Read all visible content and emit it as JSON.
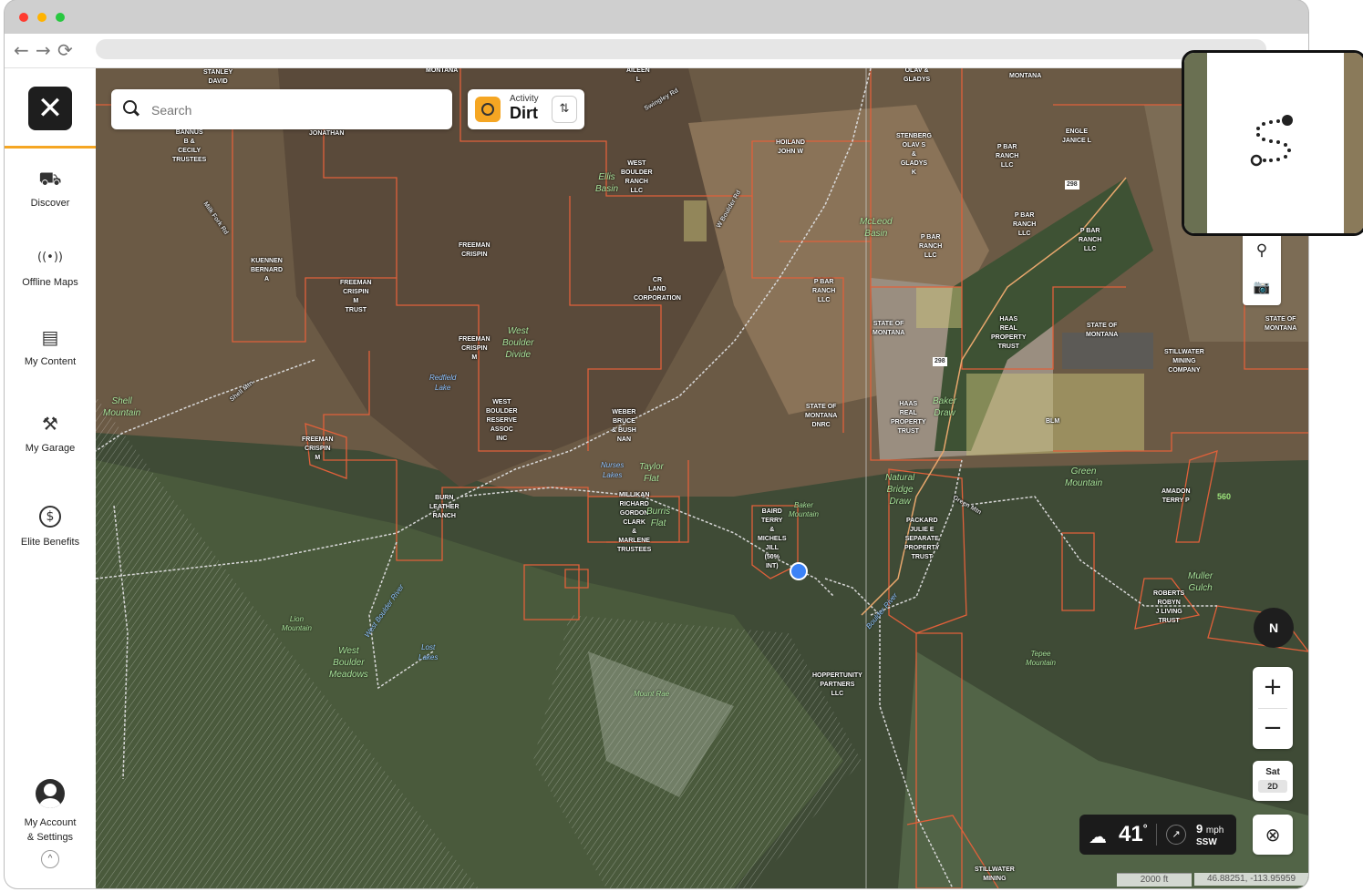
{
  "browser": {
    "traffic_lights": [
      "close",
      "minimize",
      "zoom"
    ],
    "nav": {
      "back": "←",
      "forward": "→",
      "reload": "⟳"
    }
  },
  "sidebar": {
    "logo": "✕",
    "items": [
      {
        "label": "Discover",
        "icon": "discover-icon",
        "glyph": "⛟"
      },
      {
        "label": "Offline Maps",
        "icon": "offline-maps-icon",
        "glyph": "((•))"
      },
      {
        "label": "My Content",
        "icon": "my-content-icon",
        "glyph": "▤"
      },
      {
        "label": "My Garage",
        "icon": "my-garage-icon",
        "glyph": "⚒"
      },
      {
        "label": "Elite Benefits",
        "icon": "elite-benefits-icon",
        "glyph": "$"
      }
    ],
    "account": {
      "line1": "My Account",
      "line2": "& Settings",
      "collapse": "^"
    }
  },
  "search": {
    "placeholder": "Search",
    "value": ""
  },
  "activity": {
    "caption": "Activity",
    "value": "Dirt",
    "filter_glyph": "⇅"
  },
  "tools": {
    "pin": "⚲",
    "camera": "📷"
  },
  "compass": {
    "label": "N"
  },
  "zoom": {
    "in": "+",
    "out": "−"
  },
  "layer": {
    "type": "Sat",
    "mode": "2D"
  },
  "locate": {
    "glyph": "⊗"
  },
  "weather": {
    "temp": "41",
    "degree": "°",
    "wind_speed": "9",
    "wind_unit": "mph",
    "wind_dir": "SSW"
  },
  "scale": "2000 ft",
  "coords": "46.88251, -113.95959",
  "map_labels": {
    "owners": [
      "STANLEY\nDAVID",
      "MONTANA",
      "AILEEN\nL",
      "OLAV &\nGLADYS",
      "MONTANA",
      "BANNUS\nB &\nCECILY\nTRUSTEES",
      "JONATHAN",
      "HOILAND\nJOHN W",
      "STENBERG\nOLAV S\n&\nGLADYS\nK",
      "P BAR\nRANCH\nLLC",
      "ENGLE\nJANICE L",
      "WEST\nBOULDER\nRANCH\nLLC",
      "P BAR\nRANCH\nLLC",
      "P BAR\nRANCH\nLLC",
      "P BAR\nRANCH\nLLC",
      "FREEMAN\nCRISPIN",
      "KUENNEN\nBERNARD\nA",
      "FREEMAN\nCRISPIN\nM\nTRUST",
      "CR\nLAND\nCORPORATION",
      "P BAR\nRANCH\nLLC",
      "STATE OF\nMONTANA",
      "HAAS\nREAL\nPROPERTY\nTRUST",
      "STATE OF\nMONTANA",
      "STATE OF\nMONTANA",
      "FREEMAN\nCRISPIN\nM",
      "STILLWATER\nMINING\nCOMPANY",
      "WEST\nBOULDER\nRESERVE\nASSOC\nINC",
      "WEBER\nBRUCE\n& BUSH\nNAN",
      "STATE OF\nMONTANA\nDNRC",
      "HAAS\nREAL\nPROPERTY\nTRUST",
      "BLM",
      "FREEMAN\nCRISPIN\nM",
      "BURN\nLEATHER\nRANCH",
      "MILLIKAN\nRICHARD\nGORDON\nCLARK\n&\nMARLENE\nTRUSTEES",
      "BAIRD\nTERRY\n&\nMICHELS\nJILL\n(50%\nINT)",
      "PACKARD\nJULIE E\nSEPARATE\nPROPERTY\nTRUST",
      "AMADON\nTERRY P",
      "ROBERTS\nROBYN\nJ LIVING\nTRUST",
      "HOPPERTUNITY\nPARTNERS\nLLC",
      "STILLWATER\nMINING"
    ],
    "places": [
      "Ellis\nBasin",
      "McLeod\nBasin",
      "West\nBoulder\nDivide",
      "Shell\nMountain",
      "Baker\nDraw",
      "Taylor\nFlat",
      "Natural\nBridge\nDraw",
      "Green\nMountain",
      "Burris\nFlat",
      "Baker\nMountain",
      "Lion\nMountain",
      "West\nBoulder\nMeadows",
      "Tepee\nMountain",
      "Mount Rae",
      "Muller\nGulch"
    ],
    "water": [
      "Redfield\nLake",
      "Nurses\nLakes",
      "Lost\nLakes",
      "Boulder River",
      "West Boulder River"
    ],
    "roads": [
      "298",
      "298",
      "Swingley Rd",
      "Shell Mtn",
      "Milk Fork Rd",
      "W Boulder Rd",
      "Green Mtn"
    ],
    "elevation": "560"
  },
  "colors": {
    "accent": "#f5a623",
    "parcel_line": "#e0603a",
    "location_dot": "#3b82f6"
  }
}
